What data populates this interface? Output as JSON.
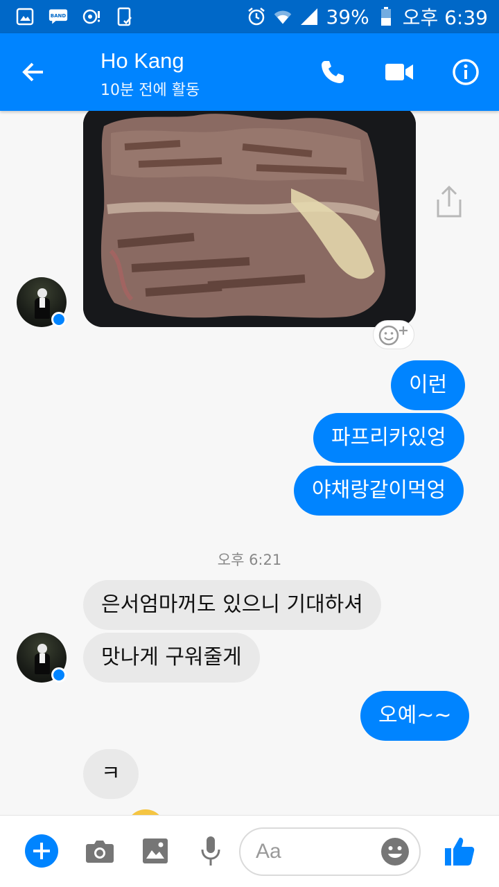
{
  "status_bar": {
    "left_icons": [
      "gallery-icon",
      "band-icon",
      "music-icon",
      "phone-check-icon"
    ],
    "band_label": "BAND",
    "battery": "39%",
    "time": "오후 6:39"
  },
  "header": {
    "name": "Ho Kang",
    "status": "10분 전에 활동"
  },
  "messages": {
    "outgoing_1": "이런",
    "outgoing_2": "파프리카있엉",
    "outgoing_3": "야채랑같이먹엉",
    "timestamp": "오후 6:21",
    "incoming_1": "은서엄마꺼도 있으니 기대하셔",
    "incoming_2": "맛나게 구워줄게",
    "outgoing_4": "오예~~",
    "incoming_3": "ㅋ"
  },
  "composer": {
    "placeholder": "Aa"
  },
  "colors": {
    "status_bar": "#0068c8",
    "app_bar": "#0084ff",
    "outgoing_bubble": "#0084ff",
    "incoming_bubble": "#e9e9e9"
  }
}
